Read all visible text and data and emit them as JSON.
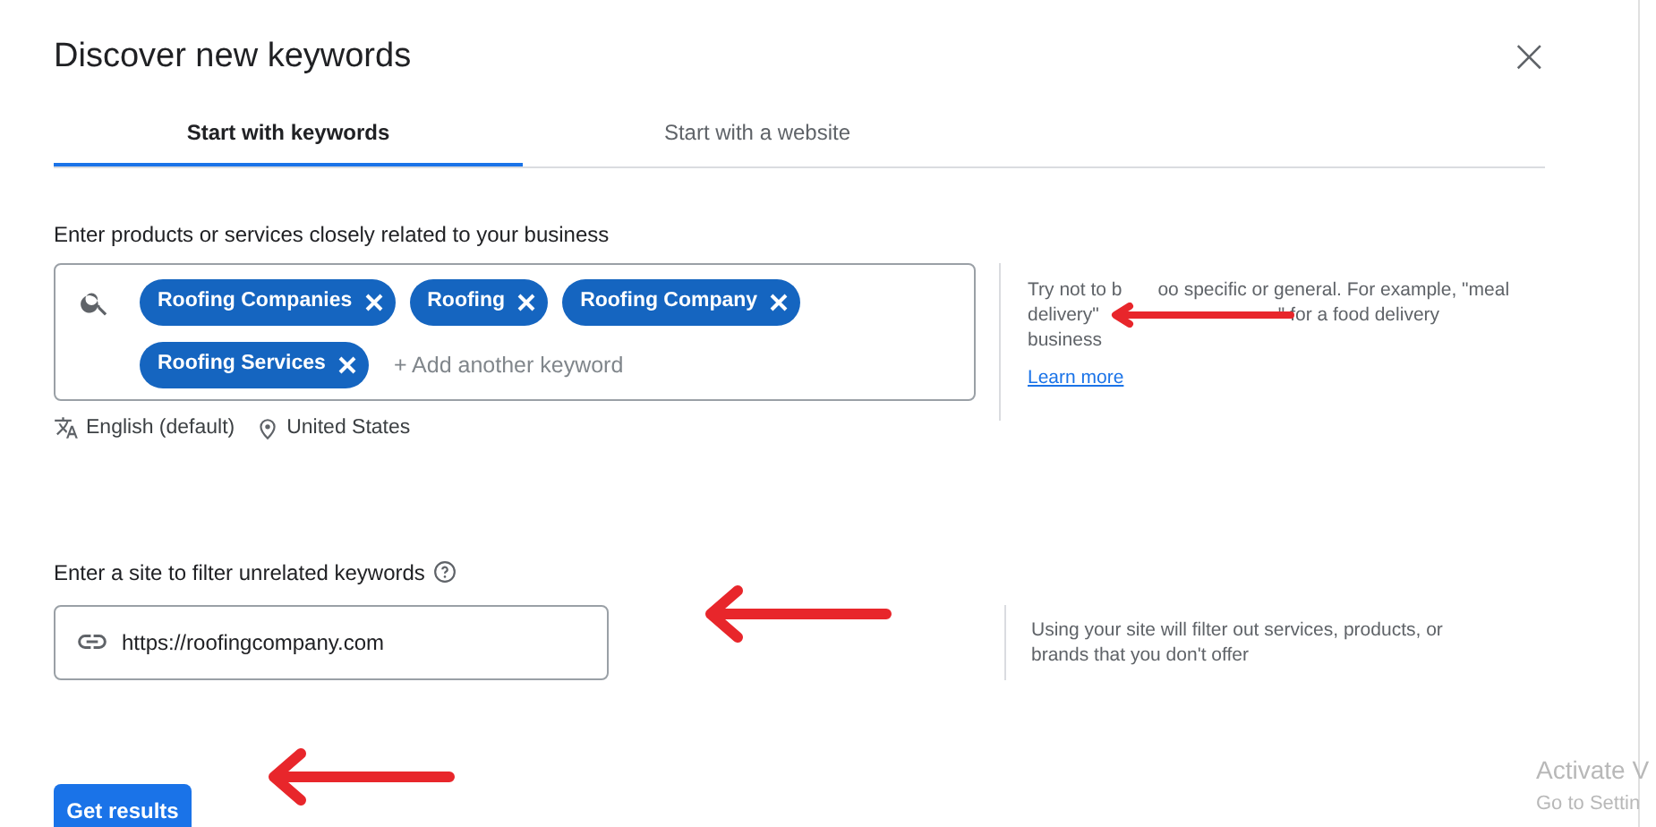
{
  "dialog": {
    "title": "Discover new keywords",
    "close": "×"
  },
  "tabs": [
    {
      "label": "Start with keywords",
      "selected": true
    },
    {
      "label": "Start with a website",
      "selected": false
    }
  ],
  "keywords": {
    "label": "Enter products or services closely related to your business",
    "chips": [
      {
        "label": "Roofing Companies"
      },
      {
        "label": "Roofing"
      },
      {
        "label": "Roofing Company"
      },
      {
        "label": "Roofing Services"
      }
    ],
    "placeholder": "+ Add another keyword",
    "language": "English (default)",
    "location": "United States",
    "hint_lines": [
      [
        "Try not to b",
        "oo specific or general. For example, \"meal"
      ],
      [
        "delivery\"",
        "\" for a food delivery"
      ],
      [
        "business"
      ]
    ],
    "learn_more": "Learn more"
  },
  "site": {
    "label": "Enter a site to filter unrelated keywords",
    "value": "https://roofingcompany.com",
    "hint": "Using your site will filter out services, products, or brands that you don't offer"
  },
  "button": "Get results",
  "annotations": [
    {
      "kind": "arrow"
    },
    {
      "kind": "arrow"
    },
    {
      "kind": "arrow"
    }
  ],
  "os_notice": [
    "Activate V",
    "Go to Settin"
  ]
}
